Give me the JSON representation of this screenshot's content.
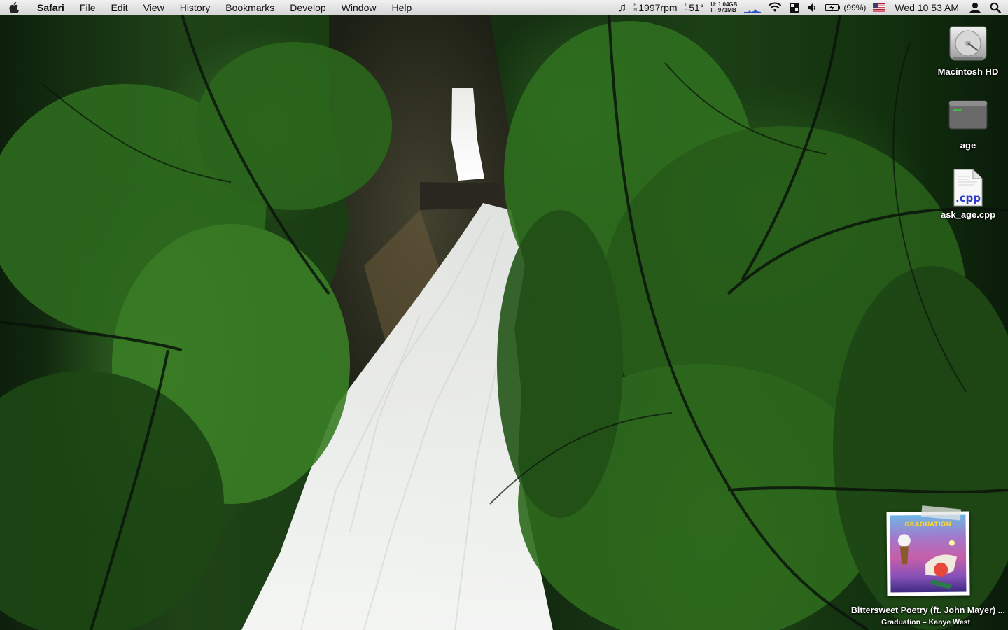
{
  "menubar": {
    "app_name": "Safari",
    "menus": [
      "File",
      "Edit",
      "View",
      "History",
      "Bookmarks",
      "Develop",
      "Window",
      "Help"
    ],
    "status": {
      "fan_label_top": "F",
      "fan_label_bottom": "N",
      "fan_speed": "1997rpm",
      "temp_label_top": "T",
      "temp_label_bottom": "P",
      "temperature": "51°",
      "mem_label_u": "U:",
      "mem_label_f": "F:",
      "mem_used": "1.04GB",
      "mem_free": "971MB",
      "battery": "(99%)",
      "clock": "Wed 10 53 AM"
    }
  },
  "desktop": {
    "icons": [
      {
        "label": "Macintosh HD",
        "icon": "hard-drive-icon"
      },
      {
        "label": "age",
        "icon": "unix-executable-icon"
      },
      {
        "label": "ask_age.cpp",
        "icon": "cpp-file-icon",
        "ext": ".cpp",
        "exec_badge": "exec"
      }
    ]
  },
  "now_playing": {
    "track": "Bittersweet Poetry (ft. John Mayer) ...",
    "album_artist": "Graduation – Kanye West",
    "cover_text": "GRADUATION"
  },
  "colors": {
    "menubar_top": "#f2f2f2",
    "menubar_bottom": "#d6d6d6",
    "foliage": "#2e6a1e",
    "waterfall": "#f4f4f2"
  }
}
